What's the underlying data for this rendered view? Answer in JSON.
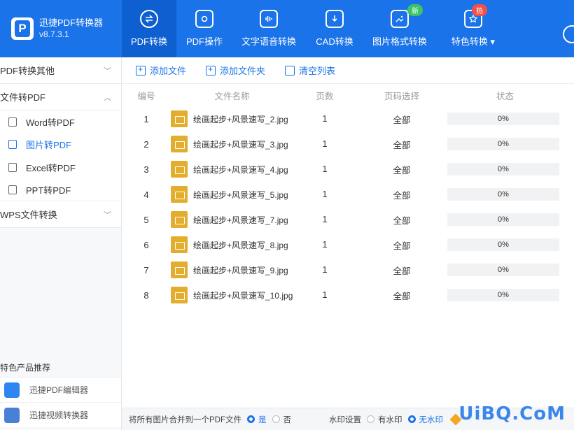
{
  "app": {
    "name": "迅捷PDF转换器",
    "version": "v8.7.3.1",
    "logo_letter": "P"
  },
  "nav": {
    "tabs": [
      {
        "label": "PDF转换",
        "icon": "swap-icon",
        "badge": ""
      },
      {
        "label": "PDF操作",
        "icon": "cog-icon",
        "badge": ""
      },
      {
        "label": "文字语音转换",
        "icon": "audio-icon",
        "badge": ""
      },
      {
        "label": "CAD转换",
        "icon": "download-icon",
        "badge": ""
      },
      {
        "label": "图片格式转换",
        "icon": "image-icon",
        "badge": "新"
      },
      {
        "label": "特色转换 ▾",
        "icon": "star-icon",
        "badge": "热"
      }
    ]
  },
  "sidebar": {
    "groups": [
      {
        "label": "PDF转换其他",
        "chevron": "﹀"
      },
      {
        "label": "文件转PDF",
        "chevron": "︿"
      }
    ],
    "items": [
      {
        "label": "Word转PDF"
      },
      {
        "label": "图片转PDF"
      },
      {
        "label": "Excel转PDF"
      },
      {
        "label": "PPT转PDF"
      }
    ],
    "group3": {
      "label": "WPS文件转换",
      "chevron": "﹀"
    },
    "rec_title": "特色产品推荐",
    "rec_items": [
      {
        "label": "迅捷PDF编辑器"
      },
      {
        "label": "迅捷视频转换器"
      }
    ]
  },
  "toolbar": {
    "add_file": "添加文件",
    "add_folder": "添加文件夹",
    "clear_list": "清空列表"
  },
  "table": {
    "headers": [
      "编号",
      "文件名称",
      "页数",
      "页码选择",
      "状态"
    ],
    "rows": [
      {
        "no": "1",
        "name": "绘画起步+风景速写_2.jpg",
        "pages": "1",
        "range": "全部",
        "status": "0%"
      },
      {
        "no": "2",
        "name": "绘画起步+风景速写_3.jpg",
        "pages": "1",
        "range": "全部",
        "status": "0%"
      },
      {
        "no": "3",
        "name": "绘画起步+风景速写_4.jpg",
        "pages": "1",
        "range": "全部",
        "status": "0%"
      },
      {
        "no": "4",
        "name": "绘画起步+风景速写_5.jpg",
        "pages": "1",
        "range": "全部",
        "status": "0%"
      },
      {
        "no": "5",
        "name": "绘画起步+风景速写_7.jpg",
        "pages": "1",
        "range": "全部",
        "status": "0%"
      },
      {
        "no": "6",
        "name": "绘画起步+风景速写_8.jpg",
        "pages": "1",
        "range": "全部",
        "status": "0%"
      },
      {
        "no": "7",
        "name": "绘画起步+风景速写_9.jpg",
        "pages": "1",
        "range": "全部",
        "status": "0%"
      },
      {
        "no": "8",
        "name": "绘画起步+风景速写_10.jpg",
        "pages": "1",
        "range": "全部",
        "status": "0%"
      }
    ]
  },
  "bottom": {
    "merge_label": "将所有图片合并到一个PDF文件",
    "yes": "是",
    "no": "否",
    "watermark_label": "水印设置",
    "has_wm": "有水印",
    "no_wm": "无水印"
  },
  "overlay_watermark": "UiBQ.CoM",
  "colors": {
    "accent": "#1a73e8",
    "badge_new": "#3cc36a",
    "badge_hot": "#f0514a",
    "file_thumb": "#e3ad2d"
  }
}
